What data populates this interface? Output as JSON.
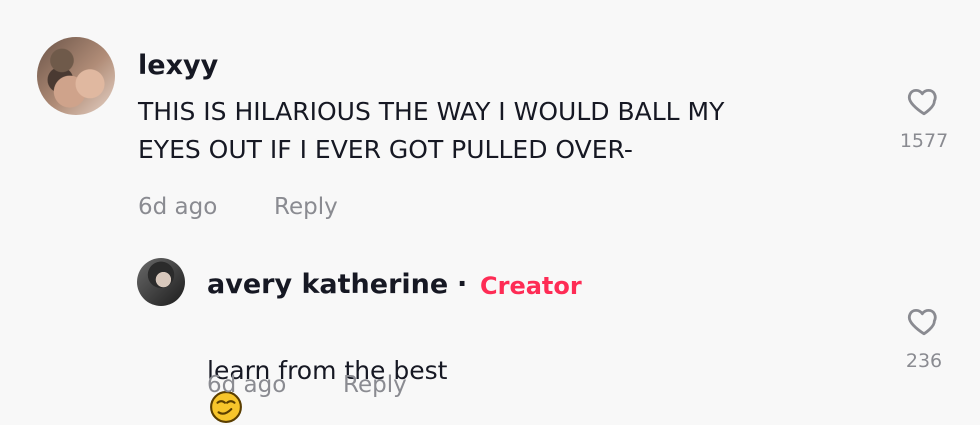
{
  "comments": [
    {
      "username": "lexyy",
      "text": "THIS IS HILARIOUS THE WAY I WOULD BALL MY\nEYES OUT IF I EVER GOT PULLED OVER-",
      "time": "6d ago",
      "reply_label": "Reply",
      "likes": "1577",
      "avatar_icon": "user-avatar-icon"
    }
  ],
  "reply": {
    "username": "avery katherine",
    "separator": "·",
    "badge": "Creator",
    "text": "learn from the best",
    "emoji_icon": "smirking-face-emoji",
    "time": "6d ago",
    "reply_label": "Reply",
    "likes": "236",
    "avatar_icon": "user-avatar-icon"
  },
  "colors": {
    "background": "#f8f8f8",
    "text": "#161823",
    "muted": "#8a8b91",
    "creator": "#fe2c55"
  }
}
